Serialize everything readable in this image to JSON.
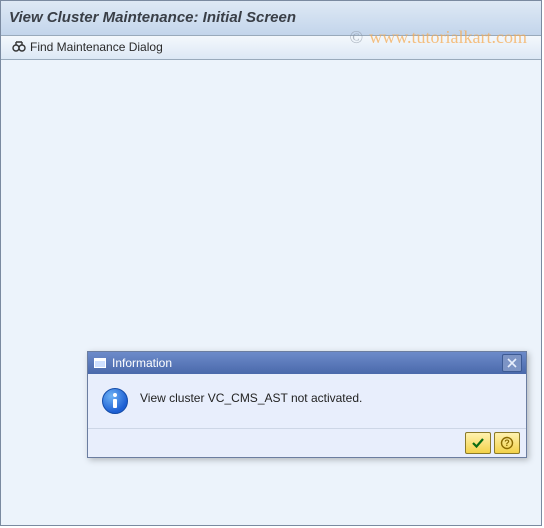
{
  "header": {
    "title": "View Cluster Maintenance: Initial Screen"
  },
  "toolbar": {
    "find_label": "Find Maintenance Dialog"
  },
  "watermark": {
    "text": "www.tutorialkart.com"
  },
  "dialog": {
    "title": "Information",
    "message": "View cluster VC_CMS_AST not activated."
  }
}
